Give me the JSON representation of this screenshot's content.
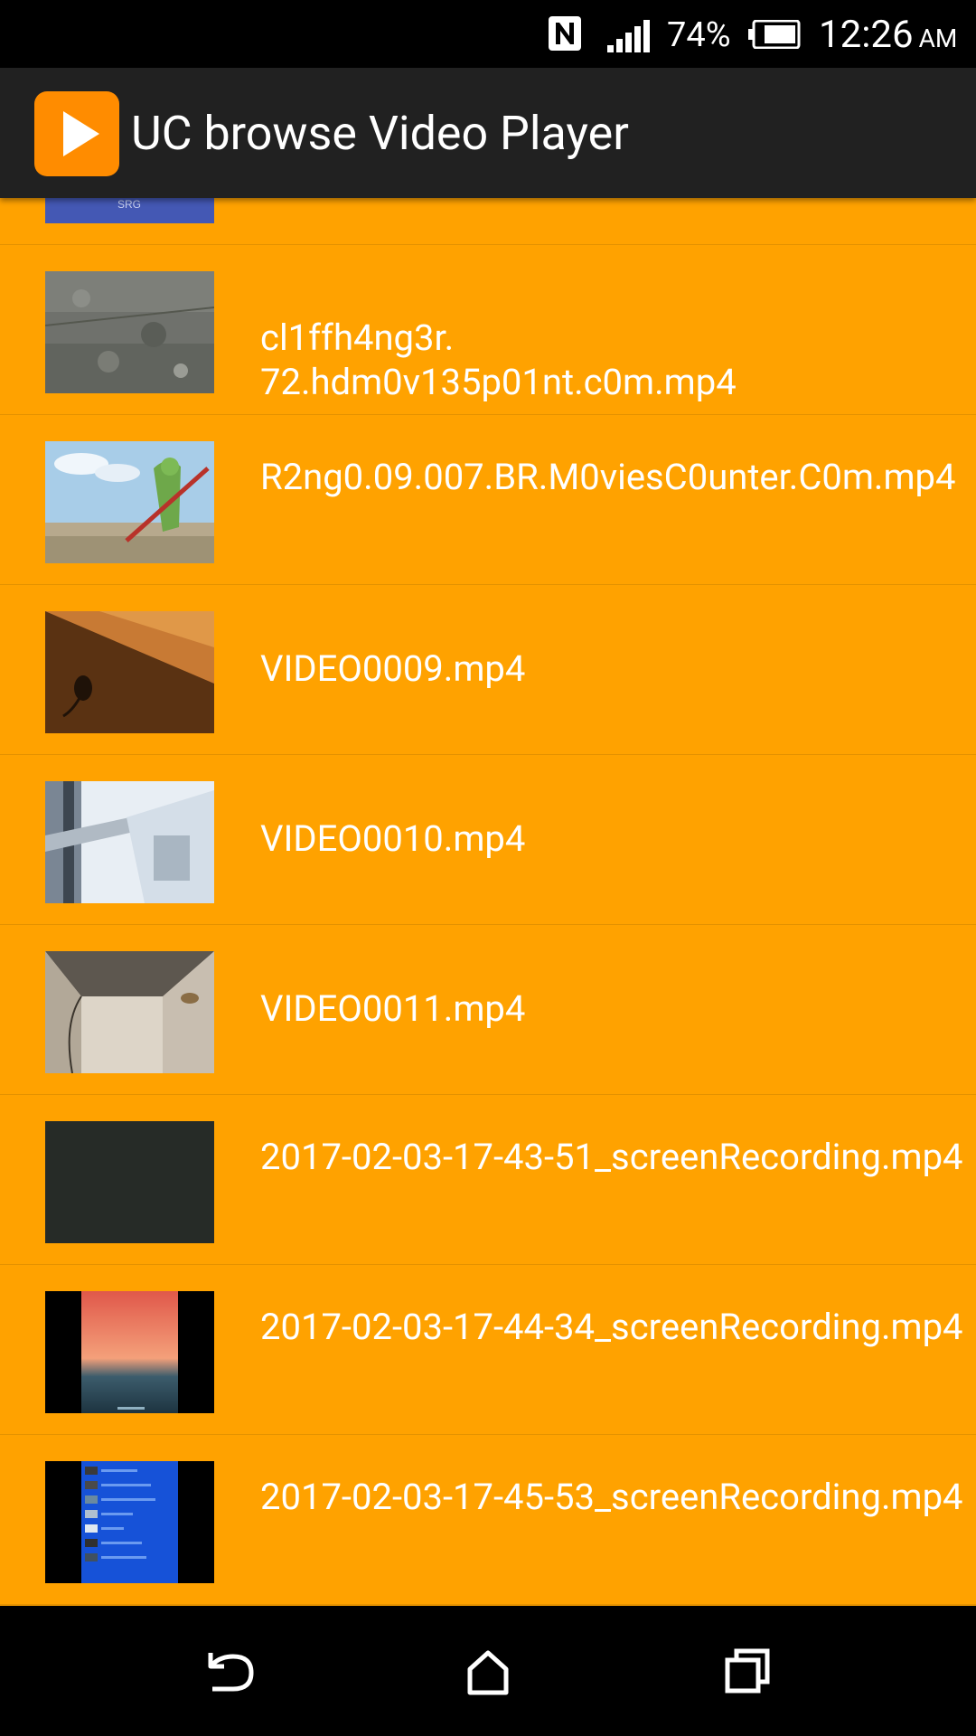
{
  "status_bar": {
    "battery_percent": "74%",
    "time": "12:26",
    "ampm": "AM",
    "icons": [
      "nfc-icon",
      "signal-icon",
      "battery-icon"
    ]
  },
  "app_bar": {
    "title": "UC browse Video Player",
    "logo_icon": "play-icon",
    "logo_color": "#FF8C00"
  },
  "colors": {
    "list_background": "#FFA200",
    "app_bar": "#212121"
  },
  "videos": [
    {
      "name": "",
      "thumbnail": "blue-title-frame"
    },
    {
      "name": "cl1ffh4ng3r.\n72.hdm0v135p01nt.c0m.mp4",
      "thumbnail": "rock-texture"
    },
    {
      "name": "R2ng0.09.007.BR.M0viesC0unter.C0m.mp4",
      "thumbnail": "cartoon-lizard"
    },
    {
      "name": "VIDEO0009.mp4",
      "thumbnail": "brown-surface"
    },
    {
      "name": "VIDEO0010.mp4",
      "thumbnail": "window-frame"
    },
    {
      "name": "VIDEO0011.mp4",
      "thumbnail": "room-corner"
    },
    {
      "name": "2017-02-03-17-43-51_screenRecording.mp4",
      "thumbnail": "dark-screen"
    },
    {
      "name": "2017-02-03-17-44-34_screenRecording.mp4",
      "thumbnail": "sunset-screen"
    },
    {
      "name": "2017-02-03-17-45-53_screenRecording.mp4",
      "thumbnail": "blue-list-screen"
    }
  ],
  "nav_bar": {
    "buttons": [
      "back-icon",
      "home-icon",
      "recents-icon"
    ]
  }
}
